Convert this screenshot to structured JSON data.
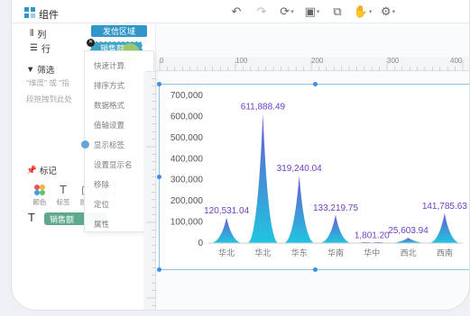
{
  "window": {
    "title": "组件"
  },
  "toolbar": {
    "icons": [
      "undo-icon",
      "redo-icon",
      "refresh-icon",
      "save-icon",
      "preview-icon",
      "hand-icon",
      "settings-icon"
    ]
  },
  "shelves": {
    "columns_label": "列",
    "rows_label": "行",
    "dropzone_label": "发信区域",
    "dragged_field": "销售额"
  },
  "filter": {
    "label": "筛选",
    "hint_line1": "\"维度\"  或  \"指",
    "hint_line2": "段拖拽到此处"
  },
  "marks": {
    "label": "标记",
    "color_label": "颜色",
    "label_label": "标签",
    "tooltip_label": "提示",
    "size_label": "大小",
    "field_pill": "销售额"
  },
  "context_menu": {
    "items": [
      "快速计算",
      "排序方式",
      "数据格式",
      "值轴设置",
      "显示标签",
      "设置显示名",
      "移除",
      "定位",
      "属性"
    ],
    "checked_index": 4
  },
  "ruler": {
    "labels": [
      "0",
      "100",
      "200",
      "300",
      "400"
    ]
  },
  "colors": {
    "accent": "#2f8fbf",
    "series_top": "#6a5acd",
    "series_bottom": "#1fc6e0",
    "label": "#6b3fc6"
  },
  "chart_data": {
    "type": "area",
    "categories": [
      "华北",
      "华北",
      "华东",
      "华南",
      "华中",
      "西北",
      "西南"
    ],
    "values": [
      120531.04,
      611888.49,
      319240.04,
      133219.75,
      1801.2,
      25603.94,
      141785.63
    ],
    "data_labels": [
      "120,531.04",
      "611,888.49",
      "319,240.04",
      "133,219.75",
      "1,801.20",
      "25,603.94",
      "141,785.63"
    ],
    "ylim": [
      0,
      700000
    ],
    "y_ticks": [
      "0",
      "100,000",
      "200,000",
      "300,000",
      "400,000",
      "500,000",
      "600,000",
      "700,000"
    ],
    "xlabel": "",
    "ylabel": "",
    "title": ""
  }
}
